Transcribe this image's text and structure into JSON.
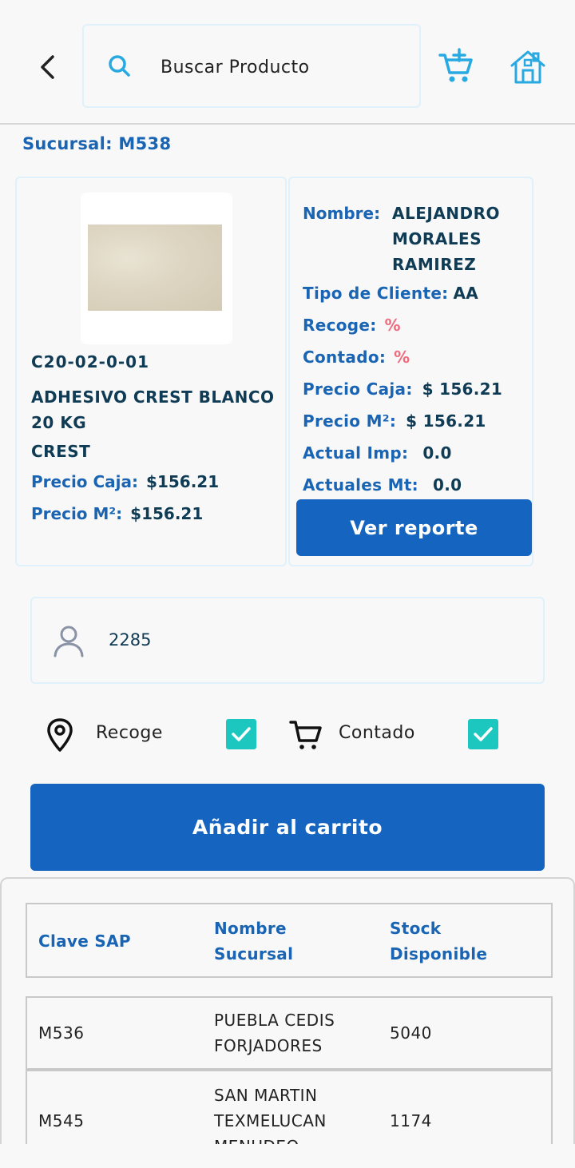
{
  "header": {
    "search_placeholder": "Buscar Producto"
  },
  "sucursal": {
    "label": "Sucursal:",
    "value": "M538"
  },
  "product": {
    "code": "C20-02-0-01",
    "name": "ADHESIVO CREST BLANCO 20 KG",
    "brand": "CREST",
    "precio_caja_label": "Precio Caja:",
    "precio_caja_value": "$156.21",
    "precio_m2_label": "Precio M²:",
    "precio_m2_value": "$156.21"
  },
  "client": {
    "nombre_label": "Nombre:",
    "nombre_value": "ALEJANDRO MORALES RAMIREZ",
    "tipo_label": "Tipo de Cliente:",
    "tipo_value": "AA",
    "recoge_label": "Recoge:",
    "recoge_value": "%",
    "contado_label": "Contado:",
    "contado_value": "%",
    "precio_caja_label": "Precio Caja:",
    "precio_caja_value": "$ 156.21",
    "precio_m2_label": "Precio M²:",
    "precio_m2_value": "$ 156.21",
    "actual_imp_label": "Actual Imp:",
    "actual_imp_value": "0.0",
    "actuales_mt_label": "Actuales Mt:",
    "actuales_mt_value": "0.0",
    "report_button": "Ver reporte"
  },
  "client_input": {
    "value": "2285"
  },
  "options": {
    "recoge_label": "Recoge",
    "recoge_checked": true,
    "contado_label": "Contado",
    "contado_checked": true
  },
  "add_to_cart_button": "Añadir al carrito",
  "stock_table": {
    "headers": [
      "Clave SAP",
      "Nombre Sucursal",
      "Stock Disponible"
    ],
    "rows": [
      {
        "clave": "M536",
        "nombre": "PUEBLA CEDIS FORJADORES",
        "stock": "5040"
      },
      {
        "clave": "M545",
        "nombre": "SAN MARTIN TEXMELUCAN MENUDEO",
        "stock": "1174"
      }
    ]
  },
  "colors": {
    "primary": "#1565c0",
    "label_blue": "#1a64b4",
    "value_dark": "#0f3b55",
    "percent_red": "#ef6b7d",
    "check_teal": "#1cc7c0",
    "icon_cyan": "#29a9e1"
  }
}
